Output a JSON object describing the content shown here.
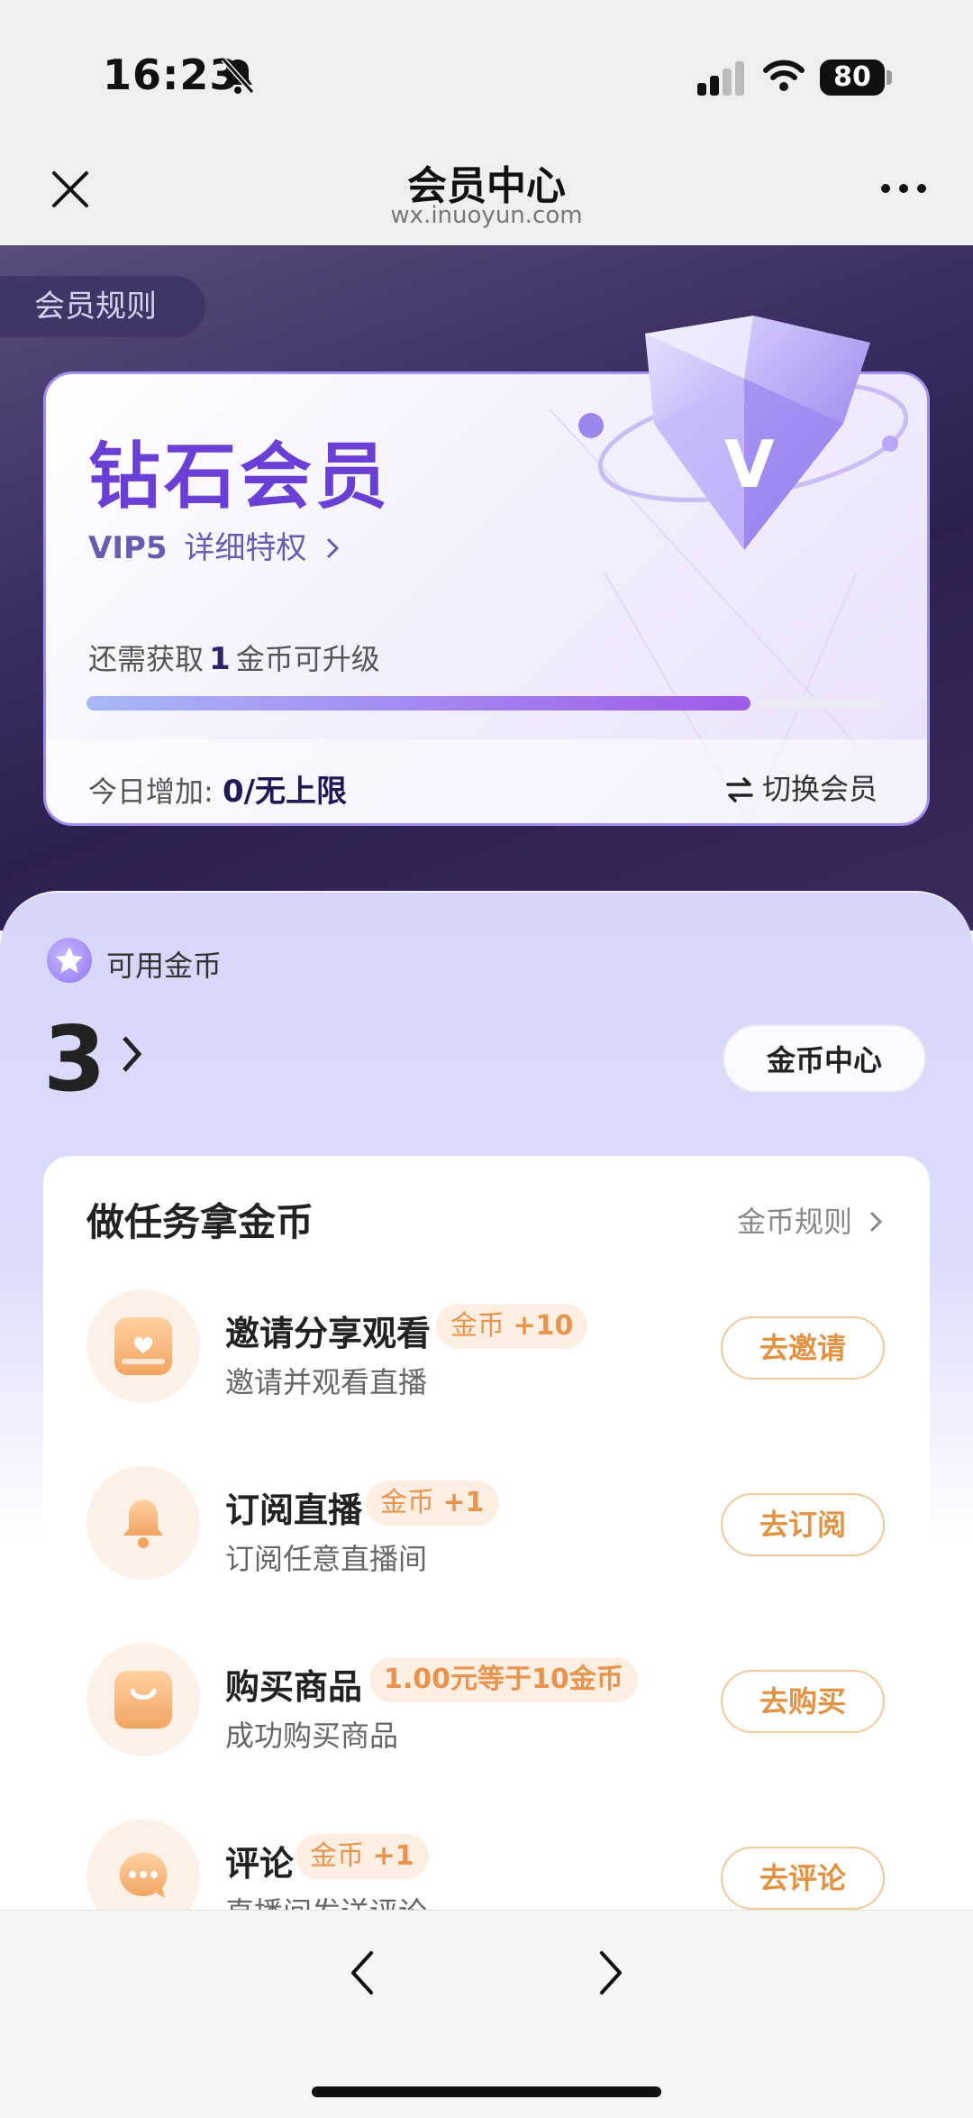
{
  "status_bar": {
    "time": "16:23",
    "battery": "80"
  },
  "nav": {
    "title": "会员中心",
    "subtitle": "wx.inuoyun.com"
  },
  "hero": {
    "rules_tag": "会员规则",
    "level_title": "钻石会员",
    "vip_level": "VIP5",
    "privileges_link": "详细特权",
    "need_prefix": "还需获取",
    "need_amount": "1",
    "need_suffix": "金币可升级",
    "progress": 0.83,
    "today_label": "今日增加:",
    "today_value": "0/无上限",
    "switch_label": "切换会员"
  },
  "coins": {
    "label": "可用金币",
    "count": "3",
    "center_button": "金币中心"
  },
  "tasks": {
    "title": "做任务拿金币",
    "rules_link": "金币规则",
    "items": [
      {
        "name": "邀请分享观看",
        "badge_prefix": "金币",
        "badge_value": "+10",
        "desc": "邀请并观看直播",
        "button": "去邀请",
        "icon": "gift-box-icon"
      },
      {
        "name": "订阅直播",
        "badge_prefix": "金币",
        "badge_value": "+1",
        "desc": "订阅任意直播间",
        "button": "去订阅",
        "icon": "bell-icon"
      },
      {
        "name": "购买商品",
        "badge_prefix": "",
        "badge_value": "1.00元等于10金币",
        "desc": "成功购买商品",
        "button": "去购买",
        "icon": "shopping-bag-icon"
      },
      {
        "name": "评论",
        "badge_prefix": "金币",
        "badge_value": "+1",
        "desc": "直播间发送评论",
        "button": "去评论",
        "icon": "chat-bubble-icon"
      }
    ]
  },
  "colors": {
    "accent_purple": "#6a3fd6",
    "task_orange": "#e39243",
    "hero_bg": "#3d2f63"
  }
}
